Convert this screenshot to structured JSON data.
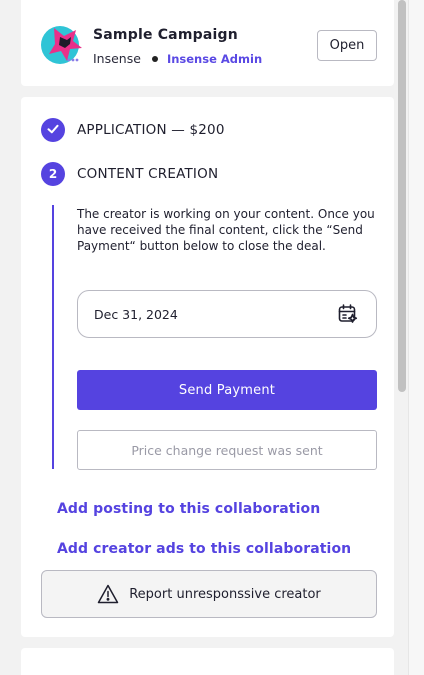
{
  "campaign": {
    "title": "Sample Campaign",
    "brand": "Insense",
    "admin": "Insense Admin",
    "open_label": "Open",
    "logo_icon": "insense-star-logo"
  },
  "steps": [
    {
      "badge": "✓",
      "badge_icon": "check-icon",
      "label": "APPLICATION — $200"
    },
    {
      "badge": "2",
      "label": "CONTENT CREATION"
    }
  ],
  "content_creation": {
    "description": "The creator is working on your content. Once you have received the final content, click the “Send Payment“ button below to close the deal.",
    "date_value": "Dec 31, 2024",
    "date_icon": "calendar-icon",
    "send_payment_label": "Send Payment",
    "price_change_label": "Price change request was sent"
  },
  "links": {
    "add_posting": "Add posting to this collaboration",
    "add_creator_ads": "Add creator ads to this collaboration"
  },
  "report": {
    "label": "Report unresponssive creator",
    "icon": "warning-icon"
  },
  "colors": {
    "accent": "#5543e0",
    "admin": "#5a49e4",
    "background": "#f2f2f2",
    "card": "#ffffff"
  }
}
